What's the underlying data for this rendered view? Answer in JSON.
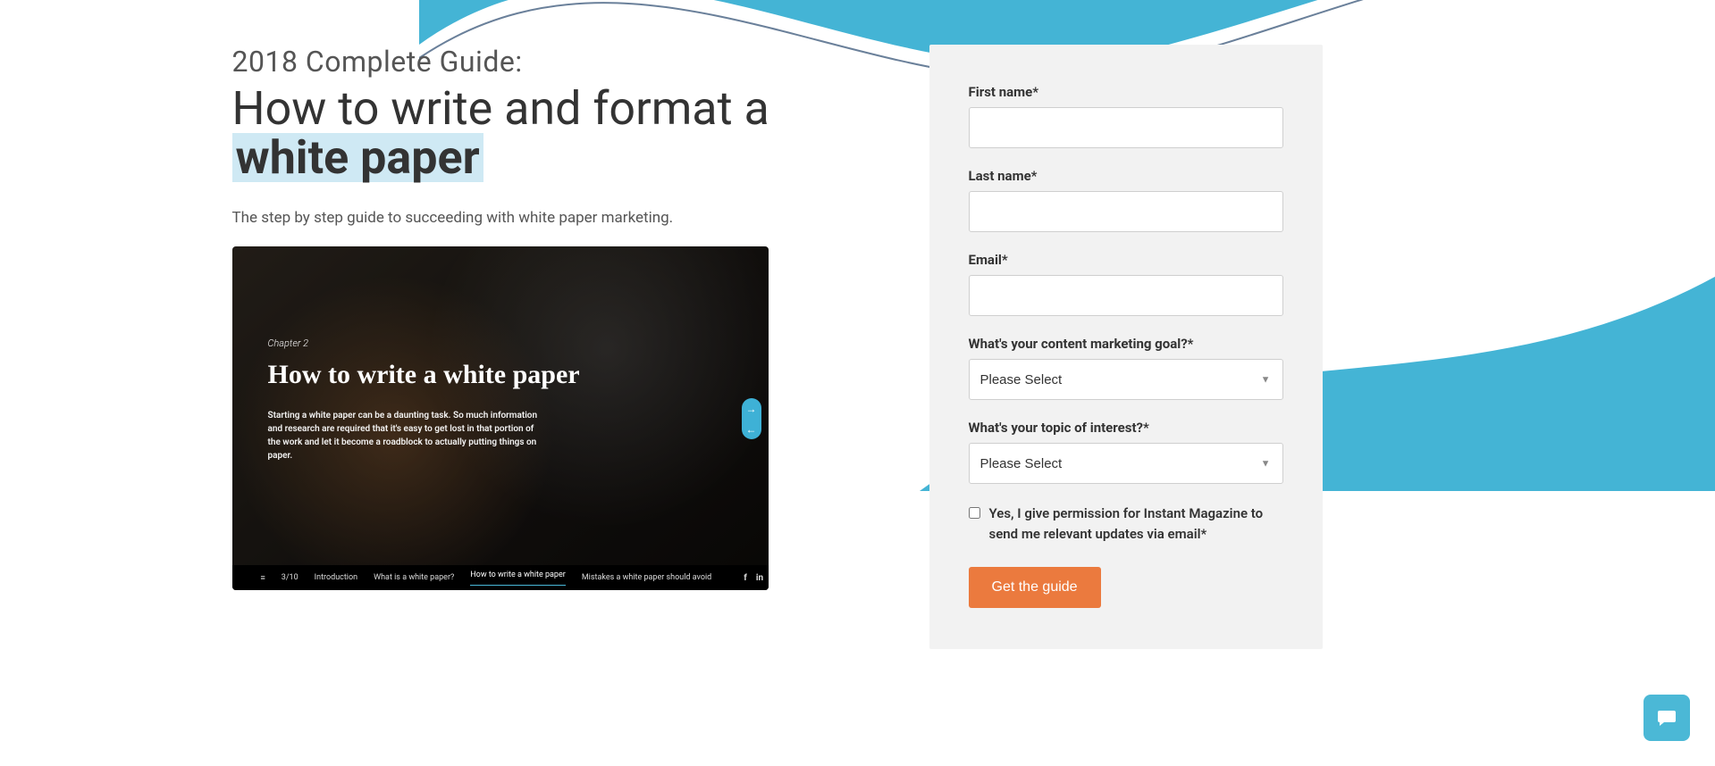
{
  "hero": {
    "eyebrow": "2018 Complete Guide:",
    "headline_pre": "How to write and format a",
    "headline_highlight": "white paper",
    "subtext": "The step by step guide to succeeding with white paper marketing."
  },
  "preview": {
    "chapter": "Chapter 2",
    "title": "How to write a white paper",
    "body": "Starting a white paper can be a daunting task. So much information and research are required that it's easy to get lost in that portion of the work and let it become a roadblock to actually putting things on paper.",
    "bar": {
      "page": "3/10",
      "items": [
        "Introduction",
        "What is a white paper?",
        "How to write a white paper",
        "Mistakes a white paper should avoid"
      ]
    }
  },
  "form": {
    "first_name": {
      "label": "First name*",
      "value": ""
    },
    "last_name": {
      "label": "Last name*",
      "value": ""
    },
    "email": {
      "label": "Email*",
      "value": ""
    },
    "goal": {
      "label": "What's your content marketing goal?*",
      "selected": "Please Select"
    },
    "topic": {
      "label": "What's your topic of interest?*",
      "selected": "Please Select"
    },
    "consent": "Yes, I give permission for Instant Magazine to send me relevant updates via email*",
    "submit": "Get the guide"
  }
}
